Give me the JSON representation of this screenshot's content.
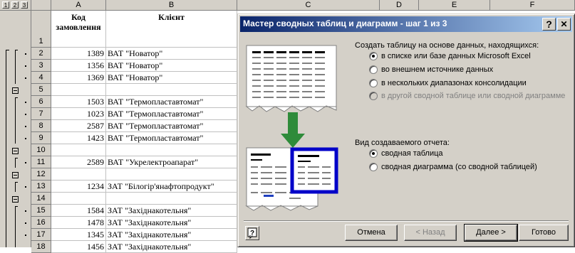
{
  "outline": {
    "levels": [
      "1",
      "2",
      "3"
    ]
  },
  "columns": [
    "A",
    "B",
    "C",
    "D",
    "E",
    "F"
  ],
  "header_row": {
    "number": "1",
    "code_label": "Код замовлення",
    "client_label": "Клієнт"
  },
  "rows": [
    {
      "n": "2",
      "code": "1389",
      "client": "ВАТ \"Новатор\""
    },
    {
      "n": "3",
      "code": "1356",
      "client": "ВАТ \"Новатор\""
    },
    {
      "n": "4",
      "code": "1369",
      "client": "ВАТ \"Новатор\""
    },
    {
      "n": "5",
      "code": "",
      "client": ""
    },
    {
      "n": "6",
      "code": "1503",
      "client": "ВАТ \"Термопластавтомат\""
    },
    {
      "n": "7",
      "code": "1023",
      "client": "ВАТ \"Термопластавтомат\""
    },
    {
      "n": "8",
      "code": "2587",
      "client": "ВАТ \"Термопластавтомат\""
    },
    {
      "n": "9",
      "code": "1423",
      "client": "ВАТ \"Термопластавтомат\""
    },
    {
      "n": "10",
      "code": "",
      "client": ""
    },
    {
      "n": "11",
      "code": "2589",
      "client": "ВАТ \"Укрелектроапарат\""
    },
    {
      "n": "12",
      "code": "",
      "client": ""
    },
    {
      "n": "13",
      "code": "1234",
      "client": "ЗАТ \"Білогір'янафтопродукт\""
    },
    {
      "n": "14",
      "code": "",
      "client": ""
    },
    {
      "n": "15",
      "code": "1584",
      "client": "ЗАТ \"Західнакотельня\""
    },
    {
      "n": "16",
      "code": "1478",
      "client": "ЗАТ \"Західнакотельня\""
    },
    {
      "n": "17",
      "code": "1345",
      "client": "ЗАТ \"Західнакотельня\""
    },
    {
      "n": "18",
      "code": "1456",
      "client": "ЗАТ \"Західнакотельня\""
    }
  ],
  "dialog": {
    "title": "Мастер сводных таблиц и диаграмм - шаг 1 из 3",
    "help_title_btn": "?",
    "close_btn": "✕",
    "source_label": "Создать таблицу на основе данных, находящихся:",
    "source_options": [
      {
        "label": "в списке или базе данных Microsoft Excel",
        "selected": true,
        "disabled": false
      },
      {
        "label": "во внешнем источнике данных",
        "selected": false,
        "disabled": false
      },
      {
        "label": "в нескольких диапазонах консолидации",
        "selected": false,
        "disabled": false
      },
      {
        "label": "в другой сводной таблице или сводной диаграмме",
        "selected": false,
        "disabled": true
      }
    ],
    "report_label": "Вид создаваемого отчета:",
    "report_options": [
      {
        "label": "сводная таблица",
        "selected": true
      },
      {
        "label": "сводная диаграмма (со сводной таблицей)",
        "selected": false
      }
    ],
    "buttons": {
      "cancel": "Отмена",
      "back": "< Назад",
      "next": "Далее >",
      "finish": "Готово"
    }
  }
}
